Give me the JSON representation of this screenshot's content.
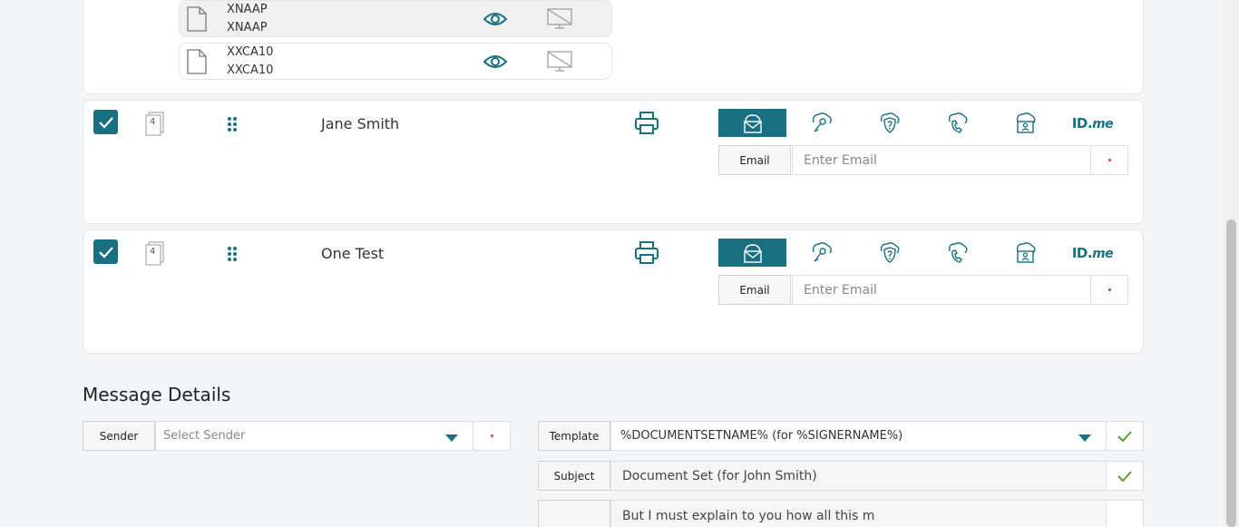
{
  "documents": [
    {
      "line1": "XNAAP",
      "line2": "XNAAP",
      "highlighted": true
    },
    {
      "line1": "XXCA10",
      "line2": "XXCA10",
      "highlighted": false
    }
  ],
  "signers": [
    {
      "order_badge": "4",
      "name": "Jane Smith",
      "auth_label": "Email",
      "email_placeholder": "Enter Email",
      "idme_prefix": "ID.",
      "idme_suffix": "me"
    },
    {
      "order_badge": "4",
      "name": "One Test",
      "auth_label": "Email",
      "email_placeholder": "Enter Email",
      "idme_prefix": "ID.",
      "idme_suffix": "me"
    }
  ],
  "message_details": {
    "title": "Message Details",
    "sender_label": "Sender",
    "sender_placeholder": "Select Sender",
    "template_label": "Template",
    "template_value": "%DOCUMENTSETNAME% (for %SIGNERNAME%)",
    "subject_label": "Subject",
    "subject_value": "Document Set (for John Smith)",
    "body_value": "But I must explain to you how all this m"
  },
  "colors": {
    "accent": "#1a6f80",
    "required": "#e0334b",
    "valid": "#5a9e3a"
  }
}
